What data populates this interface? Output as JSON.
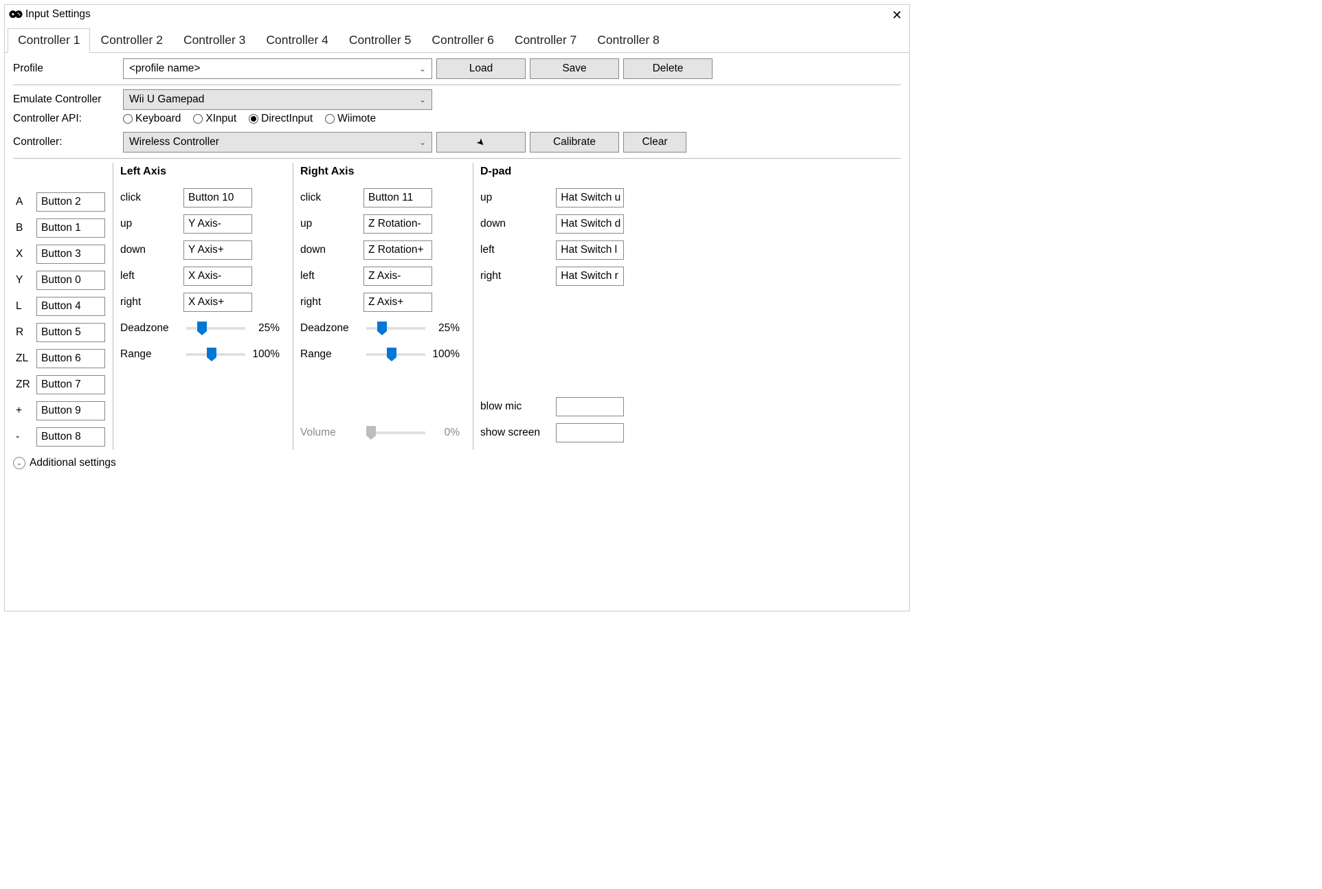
{
  "title": "Input Settings",
  "tabs": [
    "Controller 1",
    "Controller 2",
    "Controller 3",
    "Controller 4",
    "Controller 5",
    "Controller 6",
    "Controller 7",
    "Controller 8"
  ],
  "profile": {
    "label": "Profile",
    "value": "<profile name>"
  },
  "actions": {
    "load": "Load",
    "save": "Save",
    "delete": "Delete"
  },
  "emulate": {
    "label": "Emulate Controller",
    "value": "Wii U Gamepad"
  },
  "api": {
    "label": "Controller API:",
    "opts": [
      "Keyboard",
      "XInput",
      "DirectInput",
      "Wiimote"
    ]
  },
  "controller": {
    "label": "Controller:",
    "value": "Wireless Controller"
  },
  "calibrate": "Calibrate",
  "clear": "Clear",
  "buttons": [
    {
      "k": "A",
      "v": "Button 2"
    },
    {
      "k": "B",
      "v": "Button 1"
    },
    {
      "k": "X",
      "v": "Button 3"
    },
    {
      "k": "Y",
      "v": "Button 0"
    },
    {
      "k": "L",
      "v": "Button 4"
    },
    {
      "k": "R",
      "v": "Button 5"
    },
    {
      "k": "ZL",
      "v": "Button 6"
    },
    {
      "k": "ZR",
      "v": "Button 7"
    },
    {
      "k": "+",
      "v": "Button 9"
    },
    {
      "k": "-",
      "v": "Button 8"
    }
  ],
  "leftAxis": {
    "title": "Left Axis",
    "click": "Button 10",
    "up": "Y Axis-",
    "down": "Y Axis+",
    "left": "X Axis-",
    "right": "X Axis+",
    "dz": "25%",
    "range": "100%"
  },
  "rightAxis": {
    "title": "Right Axis",
    "click": "Button 11",
    "up": "Z Rotation-",
    "down": "Z Rotation+",
    "left": "Z Axis-",
    "right": "Z Axis+",
    "dz": "25%",
    "range": "100%"
  },
  "volume": {
    "label": "Volume",
    "pct": "0%"
  },
  "dpad": {
    "title": "D-pad",
    "up": "Hat Switch u",
    "down": "Hat Switch d",
    "left": "Hat Switch l",
    "right": "Hat Switch r"
  },
  "blow": {
    "label": "blow mic",
    "v": ""
  },
  "screen": {
    "label": "show screen",
    "v": ""
  },
  "labels": {
    "click": "click",
    "up": "up",
    "down": "down",
    "left": "left",
    "right": "right",
    "dz": "Deadzone",
    "range": "Range"
  },
  "addl": "Additional settings"
}
